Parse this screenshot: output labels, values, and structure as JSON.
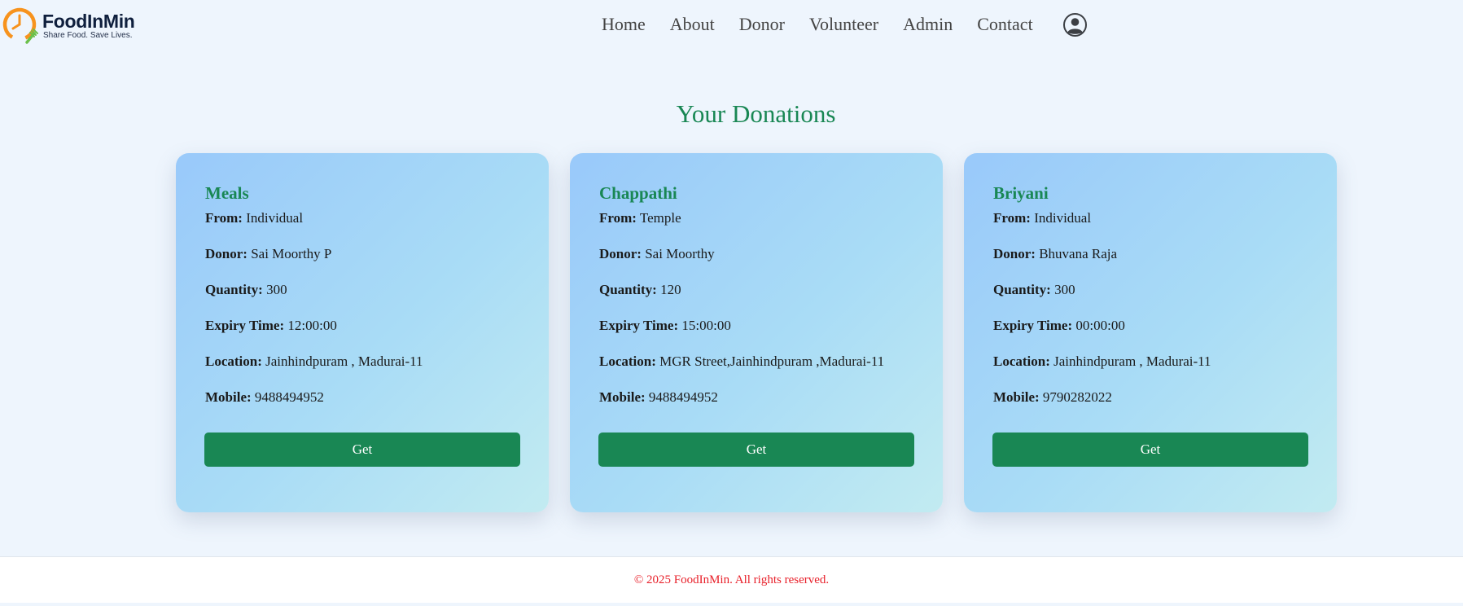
{
  "brand": {
    "name": "FoodInMin",
    "tagline": "Share Food. Save Lives."
  },
  "nav": {
    "items": [
      "Home",
      "About",
      "Donor",
      "Volunteer",
      "Admin",
      "Contact"
    ],
    "profile_icon": "user-circle-icon"
  },
  "page": {
    "title": "Your Donations"
  },
  "field_labels": {
    "from": "From:",
    "donor": "Donor:",
    "quantity": "Quantity:",
    "expiry": "Expiry Time:",
    "location": "Location:",
    "mobile": "Mobile:"
  },
  "donations": [
    {
      "name": "Meals",
      "from": "Individual",
      "donor": "Sai Moorthy P",
      "quantity": "300",
      "expiry": "12:00:00",
      "location": "Jainhindpuram , Madurai-11",
      "mobile": "9488494952",
      "button": "Get"
    },
    {
      "name": "Chappathi",
      "from": "Temple",
      "donor": "Sai Moorthy",
      "quantity": "120",
      "expiry": "15:00:00",
      "location": "MGR Street,Jainhindpuram ,Madurai-11",
      "mobile": "9488494952",
      "button": "Get"
    },
    {
      "name": "Briyani",
      "from": "Individual",
      "donor": "Bhuvana Raja",
      "quantity": "300",
      "expiry": "00:00:00",
      "location": "Jainhindpuram , Madurai-11",
      "mobile": "9790282022",
      "button": "Get"
    }
  ],
  "footer": {
    "text": "© 2025 FoodInMin. All rights reserved."
  },
  "colors": {
    "accent": "#198754",
    "background": "#eef5fd",
    "footer_text": "#e8202a",
    "logo_orange": "#f7931e",
    "logo_green": "#6cc04a"
  }
}
